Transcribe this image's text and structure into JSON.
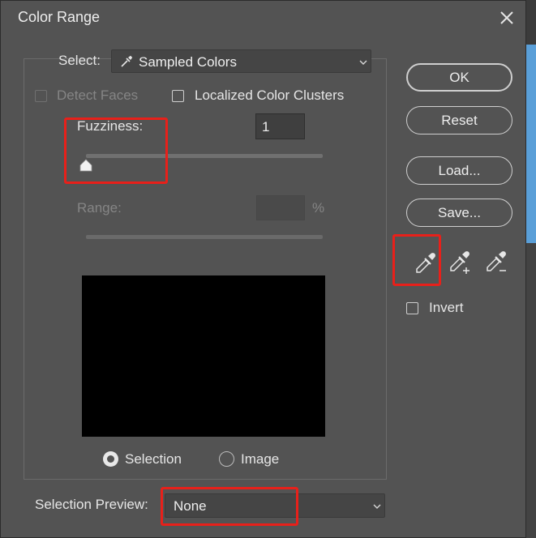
{
  "dialog": {
    "title": "Color Range"
  },
  "select": {
    "label": "Select:",
    "value": "Sampled Colors"
  },
  "options": {
    "detect_faces": {
      "label": "Detect Faces",
      "checked": false,
      "enabled": false
    },
    "localized_color_clusters": {
      "label": "Localized Color Clusters",
      "checked": false
    }
  },
  "fuzziness": {
    "label": "Fuzziness:",
    "value": "1",
    "slider_fraction": 0.0
  },
  "range": {
    "label": "Range:",
    "value": "",
    "unit": "%",
    "enabled": false
  },
  "preview_mode": {
    "selection_label": "Selection",
    "image_label": "Image",
    "selected": "Selection"
  },
  "buttons": {
    "ok": "OK",
    "reset": "Reset",
    "load": "Load...",
    "save": "Save..."
  },
  "eyedroppers": [
    "eyedropper-icon",
    "eyedropper-plus-icon",
    "eyedropper-minus-icon"
  ],
  "invert": {
    "label": "Invert",
    "checked": false
  },
  "selection_preview": {
    "label": "Selection Preview:",
    "value": "None"
  },
  "colors": {
    "dialog_bg": "#535353",
    "highlight": "#e8201a",
    "preview_bg": "#000000"
  }
}
